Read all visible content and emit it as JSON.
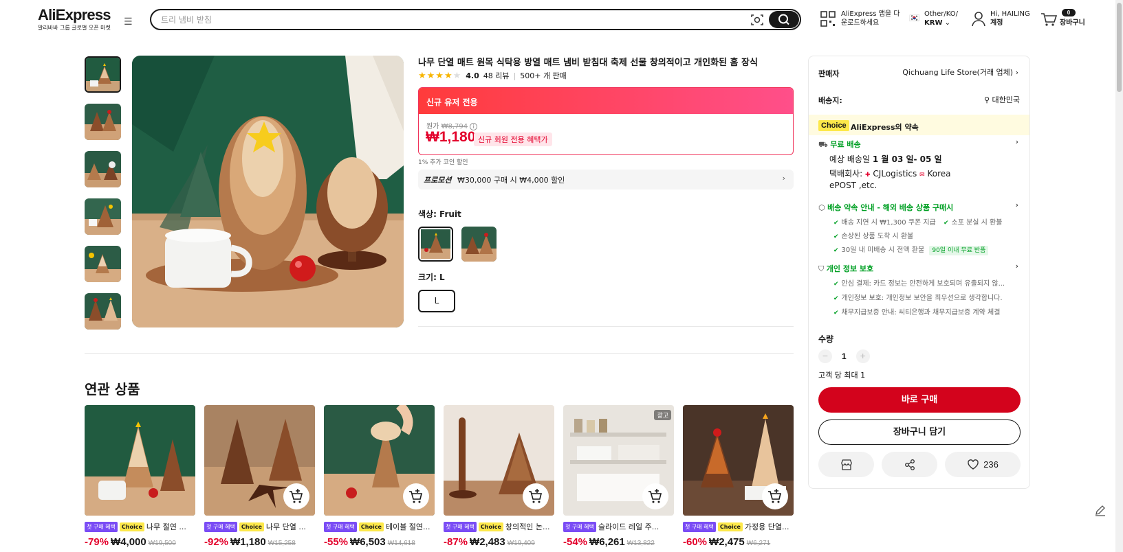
{
  "header": {
    "logo": "AliExpress",
    "logo_sub": "알리바바 그룹 글로벌 오픈 마켓",
    "search_placeholder": "트리 냄비 받침",
    "app_line1": "AliExpress 앱을 다",
    "app_line2": "운로드하세요",
    "locale_line1": "Other/KO/",
    "locale_line2": "KRW",
    "account_line1": "Hi, HAILING",
    "account_line2": "계정",
    "cart_count": "0",
    "cart_label": "장바구니"
  },
  "product": {
    "title": "나무 단열 매트 원목 식탁용 방열 매트 냄비 받침대 축제 선물 창의적이고 개인화된 홈 장식",
    "rating": "4.0",
    "reviews": "48 리뷰",
    "sold": "500+ 개 판매",
    "newuser_label": "신규 유저 전용",
    "orig_label": "원가",
    "orig_price": "₩8,794",
    "price": "₩1,180",
    "price_tag": "신규 회원 전용 혜택가",
    "coin_note": "1% 추가 코인 할인",
    "promo_label": "프로모션",
    "promo_text": "₩30,000 구매 시 ₩4,000 할인",
    "color_label": "색상: Fruit",
    "size_label": "크기: L",
    "size_option": "L"
  },
  "related": {
    "title": "연관 상품",
    "badge_first": "첫 구매 혜택",
    "badge_choice": "Choice",
    "ad_label": "광고",
    "items": [
      {
        "name": "나무 절연 ...",
        "discount": "-79%",
        "price": "₩4,000",
        "orig": "₩19,500"
      },
      {
        "name": "나무 단열 ...",
        "discount": "-92%",
        "price": "₩1,180",
        "orig": "₩15,258"
      },
      {
        "name": "테이블 절연...",
        "discount": "-55%",
        "price": "₩6,503",
        "orig": "₩14,618"
      },
      {
        "name": "창의적인 논...",
        "discount": "-87%",
        "price": "₩2,483",
        "orig": "₩19,409"
      },
      {
        "name": "슬라이드 레일 주...",
        "discount": "-54%",
        "price": "₩6,261",
        "orig": "₩13,822"
      },
      {
        "name": "가정용 단열...",
        "discount": "-60%",
        "price": "₩2,475",
        "orig": "₩6,271"
      }
    ]
  },
  "panel": {
    "seller_label": "판매자",
    "seller_name": "Qichuang Life Store(거래 업체)",
    "ship_to_label": "배송지:",
    "ship_to": "대한민국",
    "choice_badge": "Choice",
    "choice_promise": "AliExpress의 약속",
    "free_ship": "무료 배송",
    "eta_label": "예상 배송일",
    "eta": "1 월 03 일- 05 일",
    "carrier_label": "택배회사:",
    "carrier1": "CJLogistics",
    "carrier2": "Korea",
    "carrier3": "ePOST ,etc.",
    "guarantee": "배송 약속 안내 - 해외 배송 상품 구매시",
    "g1": "배송 지연 시 ₩1,300 쿠폰 지급",
    "g2": "소포 분실 시 환불",
    "g3": "손상된 상품 도착 시 환불",
    "g4": "30일 내 미배송 시 전액 환불",
    "g4_badge": "90일 이내 무료 반품",
    "privacy": "개인 정보 보호",
    "p1": "안심 결제: 카드 정보는 안전하게 보호되며 유출되지 않...",
    "p2": "개인정보 보호: 개인정보 보안을 최우선으로 생각합니다.",
    "p3": "채무지급보증 안내: 씨티은행과 채무지급보증 계약 체결",
    "qty_label": "수량",
    "qty": "1",
    "limit": "고객 당 최대 1",
    "buy_now": "바로 구매",
    "add_cart": "장바구니 담기",
    "wish_count": "236"
  },
  "colors": {
    "accent_red": "#d3031c",
    "price_red": "#e3002b",
    "green": "#00a024",
    "choice_yellow": "#fde84a"
  }
}
